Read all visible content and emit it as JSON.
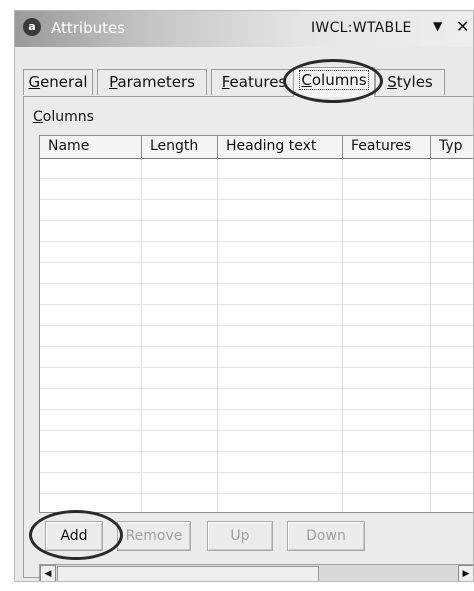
{
  "window": {
    "title": "Attributes",
    "right_title": "IWCL:WTABLE",
    "dropdown_icon": "▼",
    "close_icon": "✕",
    "app_icon": "a"
  },
  "tabs": [
    {
      "label": "General",
      "mnemonic": "G",
      "rest": "eneral"
    },
    {
      "label": "Parameters",
      "mnemonic": "P",
      "rest": "arameters"
    },
    {
      "label": "Features",
      "mnemonic": "F",
      "rest": "eatures"
    },
    {
      "label": "Columns",
      "mnemonic": "C",
      "rest": "olumns",
      "active": true
    },
    {
      "label": "Styles",
      "mnemonic": "S",
      "rest": "tyles"
    }
  ],
  "section": {
    "label": "Columns",
    "mnemonic": "C",
    "rest": "olumns"
  },
  "table": {
    "columns": [
      "Name",
      "Length",
      "Heading text",
      "Features",
      "Typ"
    ],
    "rows": []
  },
  "buttons": {
    "add": "Add",
    "remove": "Remove",
    "up": "Up",
    "down": "Down"
  },
  "scrollbar": {
    "left_arrow": "◀",
    "right_arrow": "▶"
  }
}
